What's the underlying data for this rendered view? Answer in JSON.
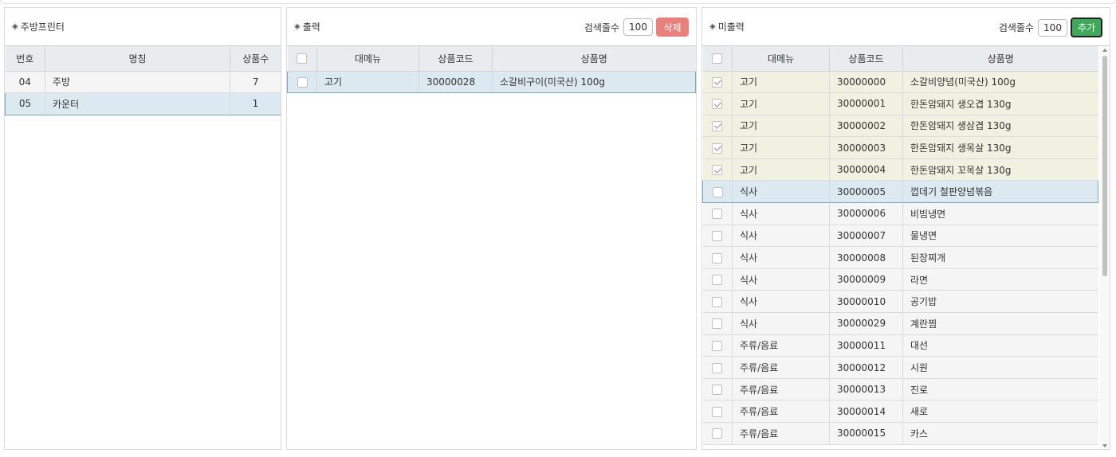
{
  "left": {
    "title": "주방프린터",
    "columns": [
      "번호",
      "명칭",
      "상품수"
    ],
    "rows": [
      {
        "no": "04",
        "name": "주방",
        "count": "7"
      },
      {
        "no": "05",
        "name": "카운터",
        "count": "1"
      }
    ]
  },
  "middle": {
    "title": "출력",
    "count_label": "검색줄수",
    "count_value": "100",
    "delete_label": "삭제",
    "columns": [
      "대메뉴",
      "상품코드",
      "상품명"
    ],
    "rows": [
      {
        "menu": "고기",
        "code": "30000028",
        "name": "소갈비구이(미국산) 100g"
      }
    ]
  },
  "right": {
    "title": "미출력",
    "count_label": "검색줄수",
    "count_value": "100",
    "add_label": "추가",
    "columns": [
      "대메뉴",
      "상품코드",
      "상품명"
    ],
    "rows": [
      {
        "menu": "고기",
        "code": "30000000",
        "name": "소갈비양념(미국산) 100g",
        "checked": true
      },
      {
        "menu": "고기",
        "code": "30000001",
        "name": "한돈암돼지 생오겹 130g",
        "checked": true
      },
      {
        "menu": "고기",
        "code": "30000002",
        "name": "한돈암돼지 생삼겹 130g",
        "checked": true
      },
      {
        "menu": "고기",
        "code": "30000003",
        "name": "한돈암돼지 생목살 130g",
        "checked": true
      },
      {
        "menu": "고기",
        "code": "30000004",
        "name": "한돈암돼지 꼬목살 130g",
        "checked": true
      },
      {
        "menu": "식사",
        "code": "30000005",
        "name": "껍데기 철판양념볶음",
        "checked": false
      },
      {
        "menu": "식사",
        "code": "30000006",
        "name": "비빔냉면",
        "checked": false
      },
      {
        "menu": "식사",
        "code": "30000007",
        "name": "물냉면",
        "checked": false
      },
      {
        "menu": "식사",
        "code": "30000008",
        "name": "된장찌개",
        "checked": false
      },
      {
        "menu": "식사",
        "code": "30000009",
        "name": "라면",
        "checked": false
      },
      {
        "menu": "식사",
        "code": "30000010",
        "name": "공기밥",
        "checked": false
      },
      {
        "menu": "식사",
        "code": "30000029",
        "name": "계란찜",
        "checked": false
      },
      {
        "menu": "주류/음료",
        "code": "30000011",
        "name": "대선",
        "checked": false
      },
      {
        "menu": "주류/음료",
        "code": "30000012",
        "name": "시원",
        "checked": false
      },
      {
        "menu": "주류/음료",
        "code": "30000013",
        "name": "진로",
        "checked": false
      },
      {
        "menu": "주류/음료",
        "code": "30000014",
        "name": "새로",
        "checked": false
      },
      {
        "menu": "주류/음료",
        "code": "30000015",
        "name": "카스",
        "checked": false
      }
    ]
  },
  "colors": {
    "delete_button": "#e8807c",
    "add_button": "#3fa85a",
    "selected_row": "#dde9f0",
    "checked_row": "#f1f1e1",
    "header_bg": "#e9ecef"
  },
  "icons": [
    "diamond-bullet-icon",
    "checkbox-icon",
    "scroll-arrow-up-icon",
    "scroll-arrow-down-icon"
  ]
}
